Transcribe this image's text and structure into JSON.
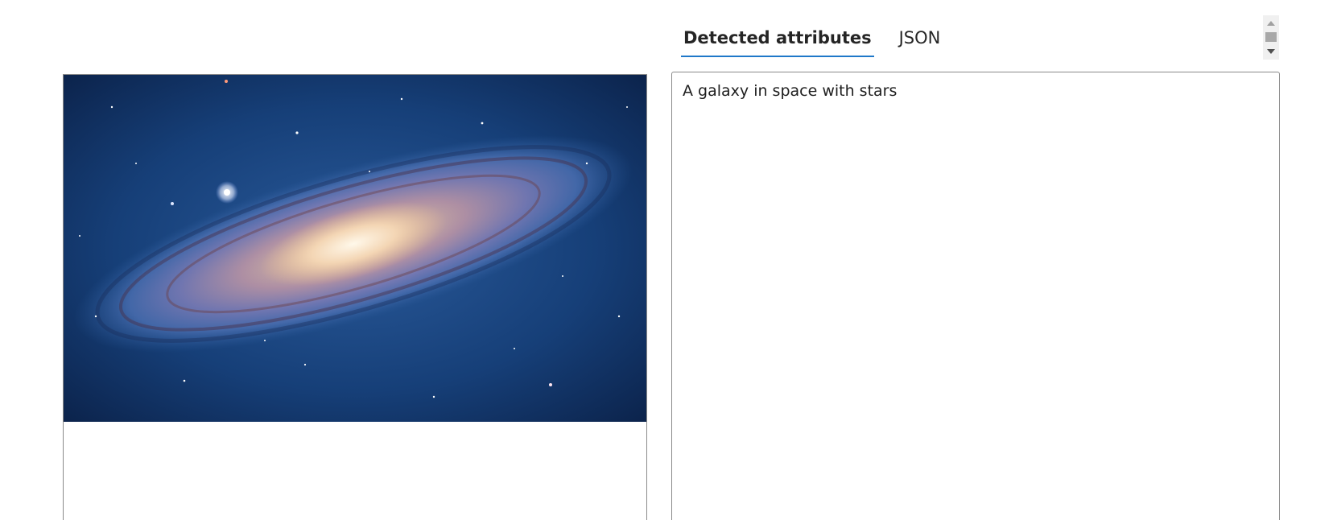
{
  "tabs": [
    {
      "label": "Detected attributes",
      "active": true
    },
    {
      "label": "JSON",
      "active": false
    }
  ],
  "result": {
    "caption": "A galaxy in space with stars"
  },
  "colors": {
    "tab_underline": "#1f78c9",
    "border": "#8a8a8a"
  },
  "icons": {
    "scroll_up": "scroll-up-arrow-icon",
    "scroll_down": "scroll-down-arrow-icon"
  }
}
